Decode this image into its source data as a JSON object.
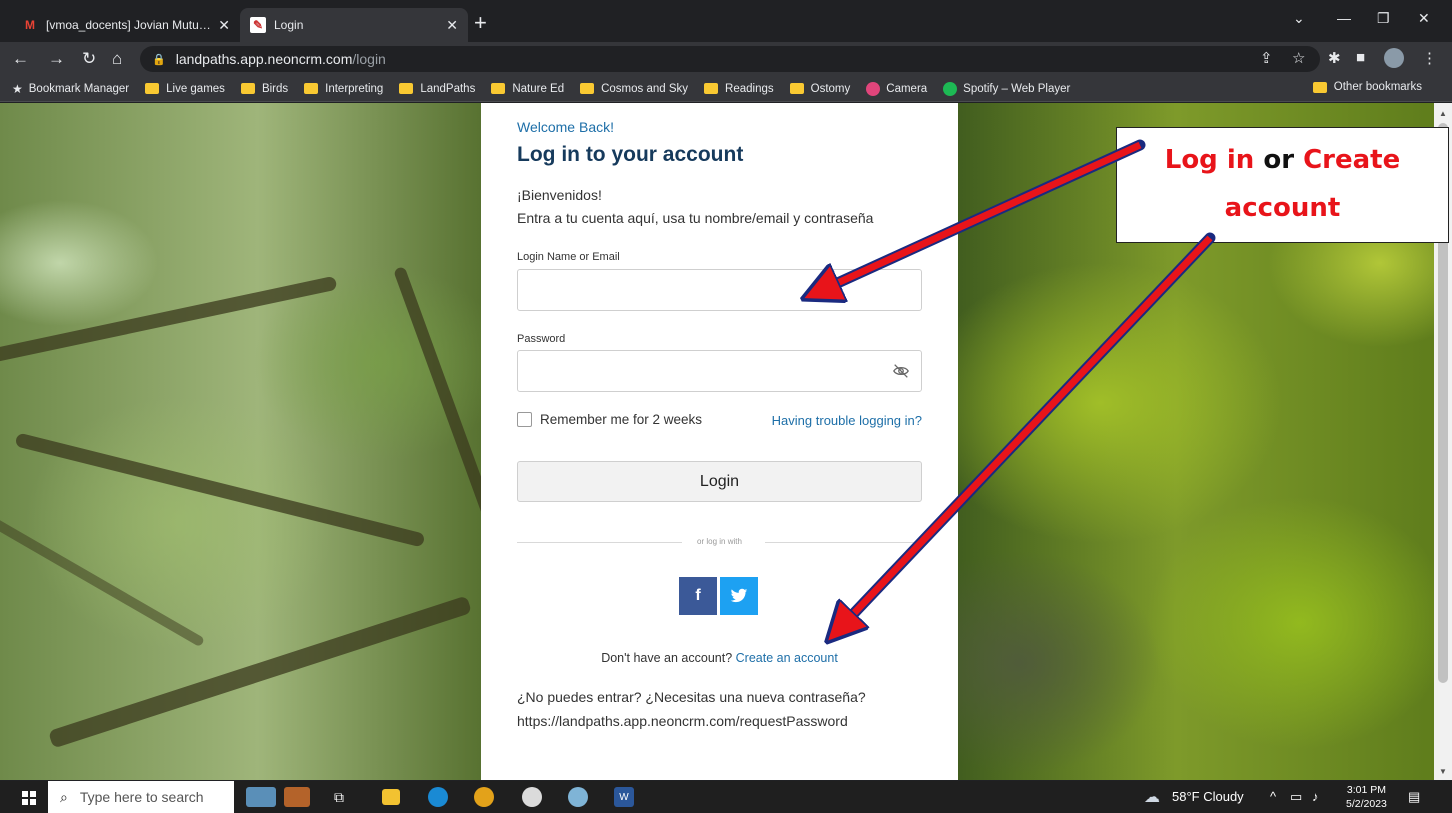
{
  "browser": {
    "tabs": [
      {
        "title": "[vmoa_docents] Jovian Mutual S",
        "favicon": "gmail-icon",
        "active": false
      },
      {
        "title": "Login",
        "favicon": "neon-icon",
        "active": true
      }
    ],
    "url_domain": "landpaths.app.neoncrm.com",
    "url_path": "/login",
    "bookmarks": [
      {
        "label": "Bookmark Manager",
        "icon": "star-icon"
      },
      {
        "label": "Live games",
        "icon": "folder-icon"
      },
      {
        "label": "Birds",
        "icon": "folder-icon"
      },
      {
        "label": "Interpreting",
        "icon": "folder-icon"
      },
      {
        "label": "LandPaths",
        "icon": "folder-icon"
      },
      {
        "label": "Nature Ed",
        "icon": "folder-icon"
      },
      {
        "label": "Cosmos and Sky",
        "icon": "folder-icon"
      },
      {
        "label": "Readings",
        "icon": "folder-icon"
      },
      {
        "label": "Ostomy",
        "icon": "folder-icon"
      },
      {
        "label": "Camera",
        "icon": "camera-app-icon"
      },
      {
        "label": "Spotify – Web Player",
        "icon": "spotify-icon"
      }
    ],
    "other_bookmarks": "Other bookmarks"
  },
  "login": {
    "welcome": "Welcome Back!",
    "heading": "Log in to your account",
    "intro_line1": "¡Bienvenidos!",
    "intro_line2": "Entra a tu cuenta aquí, usa tu nombre/email y contraseña",
    "username_label": "Login Name or Email",
    "username_value": "",
    "password_label": "Password",
    "password_value": "",
    "remember_label": "Remember me for 2 weeks",
    "trouble_link": "Having trouble logging in?",
    "login_button": "Login",
    "divider_text": "or log in with",
    "social": [
      {
        "label": "f",
        "icon": "facebook-icon"
      },
      {
        "label": "twitter",
        "icon": "twitter-icon"
      }
    ],
    "no_account_text": "Don't have an account?",
    "create_account_link": "Create an account",
    "help_line1": "¿No puedes entrar? ¿Necesitas una nueva contraseña?",
    "help_line2": "https://landpaths.app.neoncrm.com/requestPassword"
  },
  "annotation": {
    "part1": "Log in",
    "part2": "or",
    "part3": "Create",
    "part4": "account",
    "highlight_color": "#e8141a",
    "arrow_color": "#e8141a"
  },
  "taskbar": {
    "search_placeholder": "Type here to search",
    "weather": "58°F  Cloudy",
    "time": "3:01 PM",
    "date": "5/2/2023"
  }
}
